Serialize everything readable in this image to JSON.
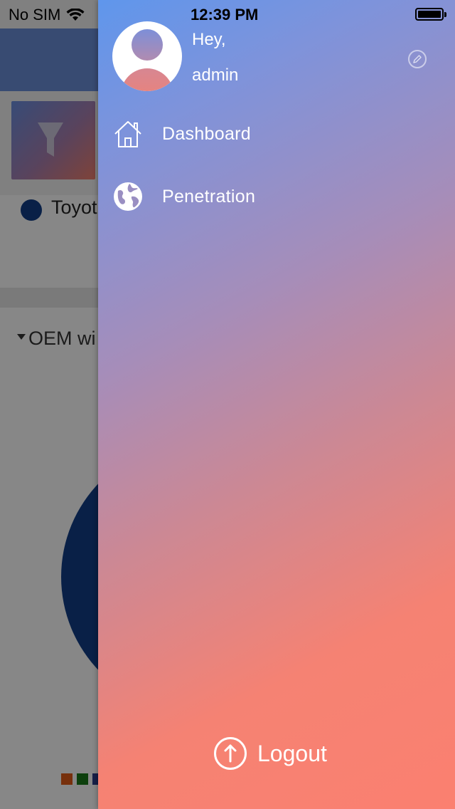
{
  "status_bar": {
    "carrier": "No SIM",
    "time": "12:39 PM"
  },
  "background": {
    "legend_text": "Toyot",
    "card_title": "OEM wi",
    "pie_color": "#123e86",
    "legend_square_colors": [
      "#e05b17",
      "#1a7a1a",
      "#2c3e8a"
    ]
  },
  "drawer": {
    "greeting": "Hey,",
    "username": "admin",
    "menu": [
      {
        "label": "Dashboard",
        "icon": "home-icon"
      },
      {
        "label": "Penetration",
        "icon": "globe-icon"
      }
    ],
    "logout_label": "Logout",
    "gradient_start": "#5f96ec",
    "gradient_end": "#fb8070"
  }
}
